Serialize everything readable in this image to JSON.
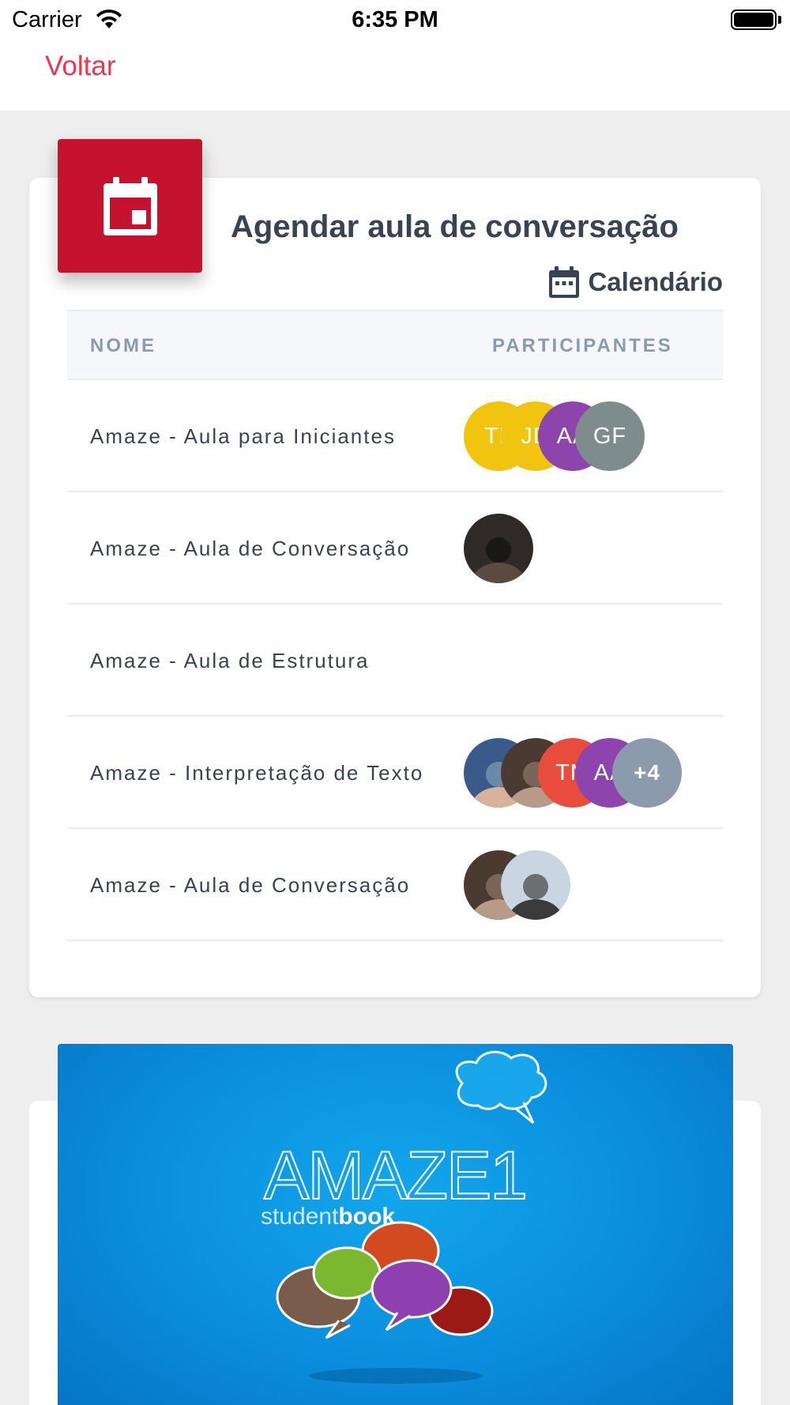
{
  "status_bar": {
    "carrier": "Carrier",
    "time": "6:35 PM"
  },
  "nav": {
    "back_label": "Voltar"
  },
  "card": {
    "title": "Agendar aula de conversação",
    "calendar_link": "Calendário",
    "accent_color": "#c4122f"
  },
  "table": {
    "headers": {
      "name": "NOME",
      "participants": "PARTICIPANTES"
    },
    "rows": [
      {
        "name": "Amaze - Aula para Iniciantes",
        "participants": [
          {
            "kind": "initials",
            "text": "TL",
            "color": "#f1c40f"
          },
          {
            "kind": "initials",
            "text": "JD",
            "color": "#f1c40f"
          },
          {
            "kind": "initials",
            "text": "AA",
            "color": "#8e44ad"
          },
          {
            "kind": "initials",
            "text": "GF",
            "color": "#7f8c8d"
          }
        ]
      },
      {
        "name": "Amaze - Aula de Conversação",
        "participants": [
          {
            "kind": "photo"
          }
        ]
      },
      {
        "name": "Amaze - Aula de Estrutura",
        "participants": []
      },
      {
        "name": "Amaze - Interpretação de Texto",
        "participants": [
          {
            "kind": "photo"
          },
          {
            "kind": "photo"
          },
          {
            "kind": "initials",
            "text": "TM",
            "color": "#e74c3c"
          },
          {
            "kind": "initials",
            "text": "AA",
            "color": "#8e44ad"
          },
          {
            "kind": "more",
            "text": "+4",
            "color": "#8c9aae"
          }
        ]
      },
      {
        "name": "Amaze - Aula de Conversação",
        "participants": [
          {
            "kind": "photo"
          },
          {
            "kind": "photo"
          }
        ]
      }
    ]
  },
  "book": {
    "title": "AMAZE1",
    "subtitle_light": "student",
    "subtitle_bold": "book"
  },
  "colors": {
    "back_link": "#f2344c",
    "text_dark": "#3a4353",
    "header_text": "#8c9aae"
  }
}
